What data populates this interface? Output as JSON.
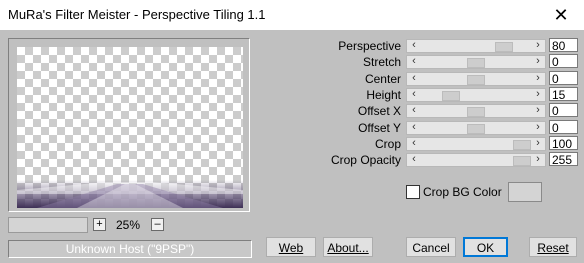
{
  "window": {
    "title": "MuRa's Filter Meister - Perspective Tiling 1.1",
    "close_glyph": "✕"
  },
  "preview": {
    "zoom_plus": "+",
    "zoom_minus": "–",
    "zoom_value": "25%",
    "host_status": "Unknown Host (\"9PSP\")",
    "tile_color": "#5a4a73"
  },
  "params": [
    {
      "label": "Perspective",
      "value": "80",
      "level": 0.8
    },
    {
      "label": "Stretch",
      "value": "0",
      "level": 0.5
    },
    {
      "label": "Center",
      "value": "0",
      "level": 0.5
    },
    {
      "label": "Height",
      "value": "15",
      "level": 0.23
    },
    {
      "label": "Offset X",
      "value": "0",
      "level": 0.5
    },
    {
      "label": "Offset Y",
      "value": "0",
      "level": 0.5
    },
    {
      "label": "Crop",
      "value": "100",
      "level": 1.0
    },
    {
      "label": "Crop Opacity",
      "value": "255",
      "level": 1.0
    }
  ],
  "crop_bg": {
    "label": "Crop BG Color",
    "checked": false
  },
  "buttons": {
    "web": "Web",
    "about": "About...",
    "cancel": "Cancel",
    "ok": "OK",
    "reset": "Reset"
  }
}
